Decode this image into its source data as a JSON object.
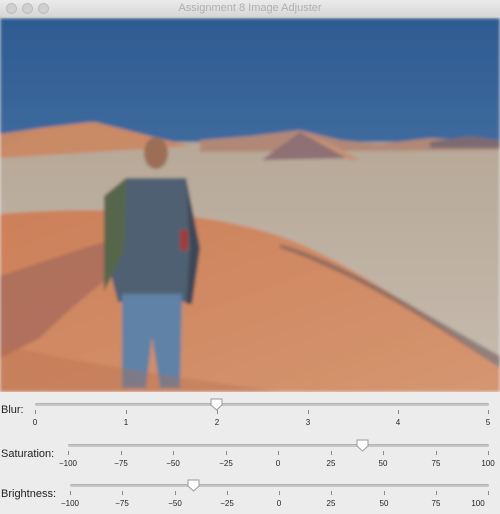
{
  "window": {
    "title": "Assignment 8 Image Adjuster"
  },
  "sliders": [
    {
      "key": "blur",
      "label": "Blur:",
      "min": 0,
      "max": 5,
      "value": 2,
      "ticks": [
        "0",
        "1",
        "2",
        "3",
        "4",
        "5"
      ]
    },
    {
      "key": "saturation",
      "label": "Saturation:",
      "min": -100,
      "max": 100,
      "value": 40,
      "ticks": [
        "−100",
        "−75",
        "−50",
        "−25",
        "0",
        "25",
        "50",
        "75",
        "100"
      ]
    },
    {
      "key": "brightness",
      "label": "Brightness:",
      "min": -100,
      "max": 100,
      "value": -40,
      "ticks": [
        "−100",
        "−75",
        "−50",
        "−25",
        "0",
        "25",
        "50",
        "75",
        "100"
      ]
    }
  ]
}
